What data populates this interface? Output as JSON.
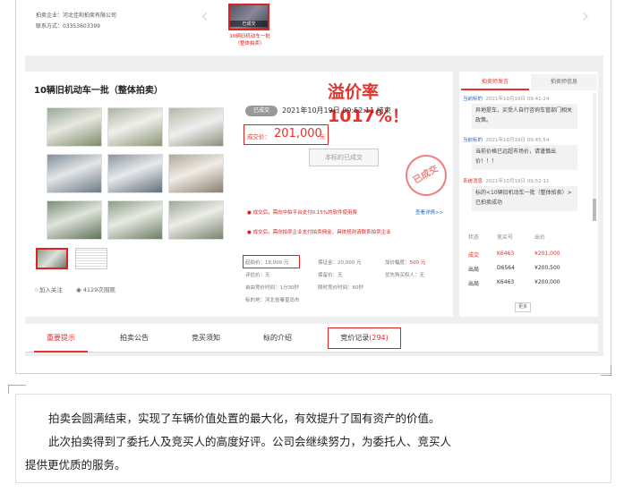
{
  "seller": {
    "company_line": "拍卖企业：河北佳和拍卖有限公司",
    "contact_line": "联系方式：03353603399",
    "prev_lot_thumb_label": "已成交",
    "prev_lot_caption_1": "10辆旧机动车一批",
    "prev_lot_caption_2": "（整体拍卖）"
  },
  "lot": {
    "title": "10辆旧机动车一批（整体拍卖）",
    "premium_rate": "溢价率1017%！",
    "status_pill": "已成交",
    "deal_time": "2021年10月19日 09:52:11 结束",
    "price_label": "成交价：",
    "price_value": "201,000",
    "price_unit": "元",
    "done_button": "本标的已成交",
    "stamp_text": "已成交",
    "notice_1": "成交后，需向中拍平台支付0.15%的软件使用费",
    "notice_link": "查看详情>>",
    "notice_2": "成交后，需向拍卖企业支付拍卖佣金，具体规则请联系拍卖企业",
    "follow": "加入关注",
    "views": "4129次围观"
  },
  "info": {
    "start_price": "起拍价：18,000 元",
    "deposit": "保证金：20,000 元",
    "increment_label": "加价幅度：",
    "increment_value": "500 元",
    "appraisal": "评估价：无",
    "retain": "保留价：无",
    "priority": "优先购买权人：无",
    "free_cycle": "自由竞价时间：1分30秒",
    "limit_cycle": "限时竞价时间：60秒",
    "location": "标的地：河北省秦皇岛市"
  },
  "side": {
    "tab_active": "拍卖师发言",
    "tab_other": "拍卖师信息",
    "messages": [
      {
        "who": "当前标的",
        "time": "2021年10月19日 09:41:24",
        "text": "异地提车，买受人自行咨询车管部门相关政策。",
        "sys": false
      },
      {
        "who": "当前标的",
        "time": "2021年10月19日 09:45:54",
        "text": "当前价格已远超市场价，请谨慎出价！！！",
        "sys": false
      },
      {
        "who": "系统消息",
        "time": "2021年10月19日 09:52:11",
        "text": "标的<10辆旧机动车一批（整体拍卖）>已拍卖成功",
        "sys": true
      }
    ],
    "headers": [
      "状态",
      "竞买号",
      "出价"
    ],
    "bids": [
      {
        "status": "成交",
        "number": "K6463",
        "price": "¥201,000",
        "win": true
      },
      {
        "status": "出局",
        "number": "D6564",
        "price": "¥200,500",
        "win": false
      },
      {
        "status": "出局",
        "number": "K6463",
        "price": "¥200,000",
        "win": false
      }
    ],
    "more": "更多"
  },
  "tabs": {
    "important": "重要提示",
    "announcement": "拍卖公告",
    "rules": "竞买须知",
    "intro": "标的介绍",
    "records_label": "竞价记录",
    "records_count": "(294)"
  },
  "article": {
    "para_1": "拍卖会圆满结束，实现了车辆价值处置的最大化，有效提升了国有资产的价值。",
    "para_2a": "此次拍卖得到了委托人及竞买人的高度好评。公司会继续努力，为委托人、竞买人",
    "para_2b": "提供更优质的服务。"
  },
  "colors": {
    "accent_red": "#e5322e",
    "link_blue": "#2a6bc1"
  }
}
